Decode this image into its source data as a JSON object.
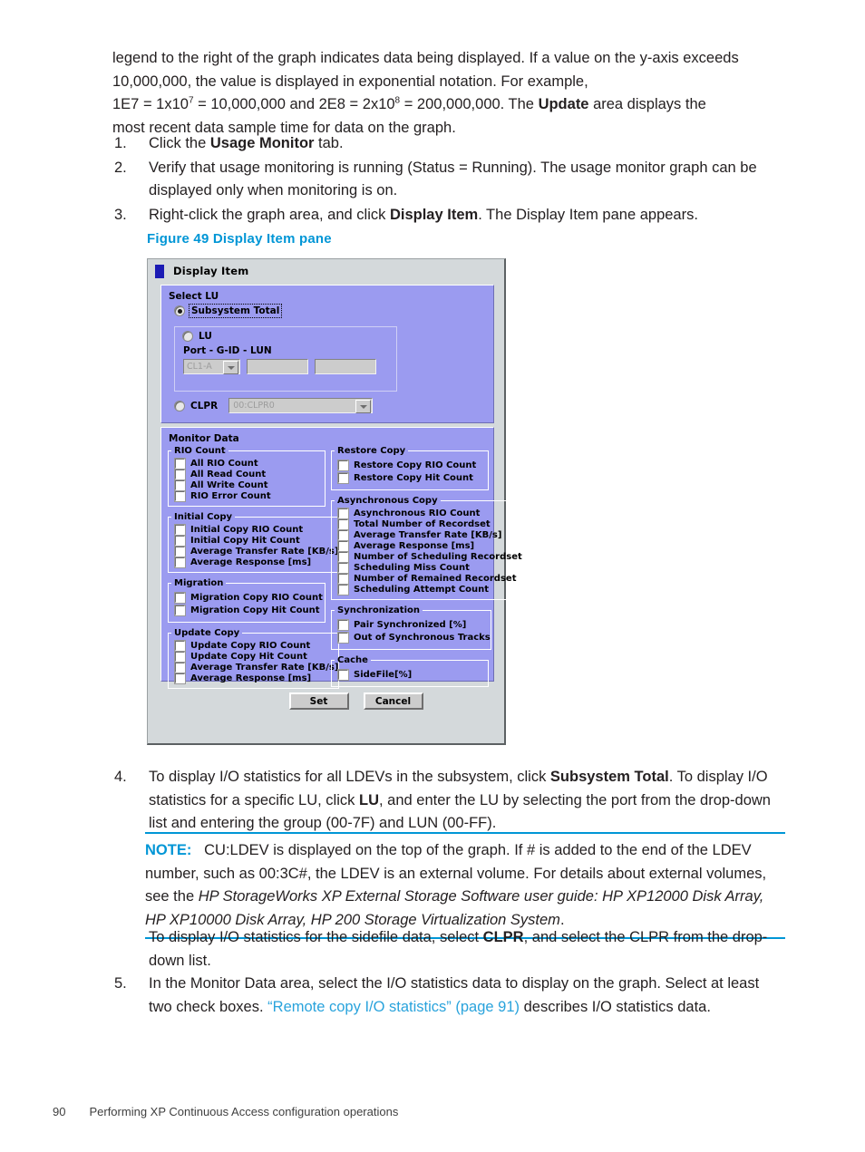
{
  "page": {
    "intro": {
      "line1": "legend to the right of the graph indicates data being displayed. If a value on the y-axis exceeds",
      "line2_a": "10,000,000, the value is displayed in exponential notation. For example,",
      "line3_a": "1E7 = 1x10",
      "line3_sup1": "7",
      "line3_b": " = 10,000,000 and 2E8 = 2x10",
      "line3_sup2": "8",
      "line3_c": " = 200,000,000. The ",
      "line3_bold": "Update",
      "line3_d": " area displays the",
      "line4": "most recent data sample time for data on the graph."
    },
    "steps": [
      {
        "num": "1.",
        "a": "Click the ",
        "bold": "Usage Monitor",
        "b": " tab."
      },
      {
        "num": "2.",
        "a": "Verify that usage monitoring is running (Status = Running). The usage monitor graph can be displayed only when monitoring is on.",
        "bold": "",
        "b": ""
      },
      {
        "num": "3.",
        "a": "Right-click the graph area, and click ",
        "bold": "Display Item",
        "b": ". The Display Item pane appears."
      }
    ],
    "figure_caption": "Figure 49 Display Item pane",
    "step4": {
      "num": "4.",
      "a": "To display I/O statistics for all LDEVs in the subsystem, click ",
      "bold1": "Subsystem Total",
      "b": ". To display I/O statistics for a specific LU, click ",
      "bold2": "LU",
      "c": ", and enter the LU by selecting the port from the drop-down list and entering the group (00-7F) and LUN (00-FF)."
    },
    "note": {
      "keyword": "NOTE:",
      "a": "CU:LDEV is displayed on the top of the graph. If # is added to the end of the LDEV number, such as 00:3C#, the LDEV is an external volume. For details about external volumes, see the ",
      "italic": "HP StorageWorks XP External Storage Software user guide: HP XP12000 Disk Array, HP XP10000 Disk Array, HP 200 Storage Virtualization System",
      "b": "."
    },
    "clpr_para": {
      "a": "To display I/O statistics for the sidefile data, select ",
      "bold": "CLPR",
      "b": ", and select the CLPR from the drop-down list."
    },
    "step5": {
      "num": "5.",
      "a": "In the Monitor Data area, select the I/O statistics data to display on the graph. Select at least two check boxes. ",
      "link": "“Remote copy I/O statistics” (page 91)",
      "b": " describes I/O statistics data."
    },
    "footer": {
      "page_number": "90",
      "title": "Performing XP Continuous Access configuration operations"
    }
  },
  "dialog": {
    "title": "Display Item",
    "select_lu": {
      "title": "Select LU",
      "subsystem_total": "Subsystem Total",
      "lu": "LU",
      "port_label": "Port - G-ID - LUN",
      "port_value": "CL1-A",
      "gid_value": "",
      "lun_value": "",
      "clpr": "CLPR",
      "clpr_value": "00:CLPR0"
    },
    "monitor_data": {
      "title": "Monitor Data",
      "left_groups": [
        {
          "legend": "RIO Count",
          "items": [
            "All RIO Count",
            "All Read Count",
            "All Write Count",
            "RIO Error Count"
          ]
        },
        {
          "legend": "Initial Copy",
          "items": [
            "Initial Copy RIO Count",
            "Initial Copy Hit Count",
            "Average Transfer Rate [KB/s]",
            "Average Response [ms]"
          ]
        },
        {
          "legend": "Migration",
          "items": [
            "Migration Copy RIO Count",
            "Migration Copy Hit Count"
          ]
        },
        {
          "legend": "Update Copy",
          "items": [
            "Update Copy RIO Count",
            "Update Copy Hit Count",
            "Average Transfer Rate [KB/s]",
            "Average Response [ms]"
          ]
        }
      ],
      "right_groups": [
        {
          "legend": "Restore Copy",
          "items": [
            "Restore Copy RIO Count",
            "Restore Copy Hit Count"
          ]
        },
        {
          "legend": "Asynchronous Copy",
          "items": [
            "Asynchronous RIO Count",
            "Total Number of Recordset",
            "Average Transfer Rate [KB/s]",
            "Average Response [ms]",
            "Number of Scheduling Recordset",
            "Scheduling Miss Count",
            "Number of Remained Recordset",
            "Scheduling Attempt Count"
          ]
        },
        {
          "legend": "Synchronization",
          "items": [
            "Pair Synchronized [%]",
            "Out of Synchronous Tracks"
          ]
        },
        {
          "legend": "Cache",
          "items": [
            "SideFile[%]"
          ]
        }
      ]
    },
    "buttons": {
      "set": "Set",
      "cancel": "Cancel"
    }
  },
  "colors": {
    "accent_blue": "#0096d6",
    "link_blue": "#29a3dc",
    "panel_purple": "#9b9bf0",
    "dialog_gray": "#d4d9db"
  }
}
